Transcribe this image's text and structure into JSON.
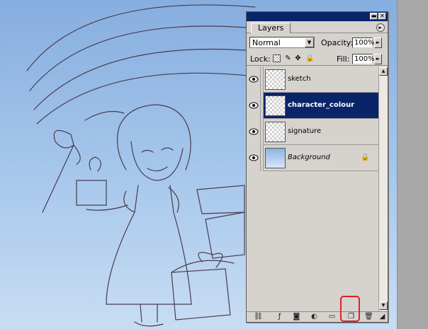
{
  "palette": {
    "tab_label": "Layers",
    "min_glyph": "▬",
    "close_glyph": "✕",
    "menu_glyph": "►",
    "blend_mode": "Normal",
    "opacity_label": "Opacity:",
    "opacity_value": "100%",
    "lock_label": "Lock:",
    "fill_label": "Fill:",
    "fill_value": "100%",
    "dropdown_glyph": "▼",
    "stepper_glyph": "►"
  },
  "lock_glyphs": {
    "image": "✎",
    "position": "✥",
    "all": "🔒"
  },
  "layers": [
    {
      "name": "sketch",
      "selected": false,
      "visible": true
    },
    {
      "name": "character_colour",
      "selected": true,
      "visible": true
    },
    {
      "name": "signature",
      "selected": false,
      "visible": true
    },
    {
      "name": "Background",
      "selected": false,
      "visible": true,
      "locked": true,
      "lock_glyph": "🔒"
    }
  ],
  "scrollbar": {
    "up_glyph": "▲",
    "down_glyph": "▼"
  },
  "bottom_bar": {
    "link": "⛓",
    "style": "ƒ",
    "mask": "◙",
    "adjust": "◐",
    "group": "▭",
    "new_layer": "❐",
    "trash": "🗑",
    "grip": "◢"
  },
  "colors": {
    "selection": "#0a246a",
    "highlight_box": "#e02020"
  }
}
